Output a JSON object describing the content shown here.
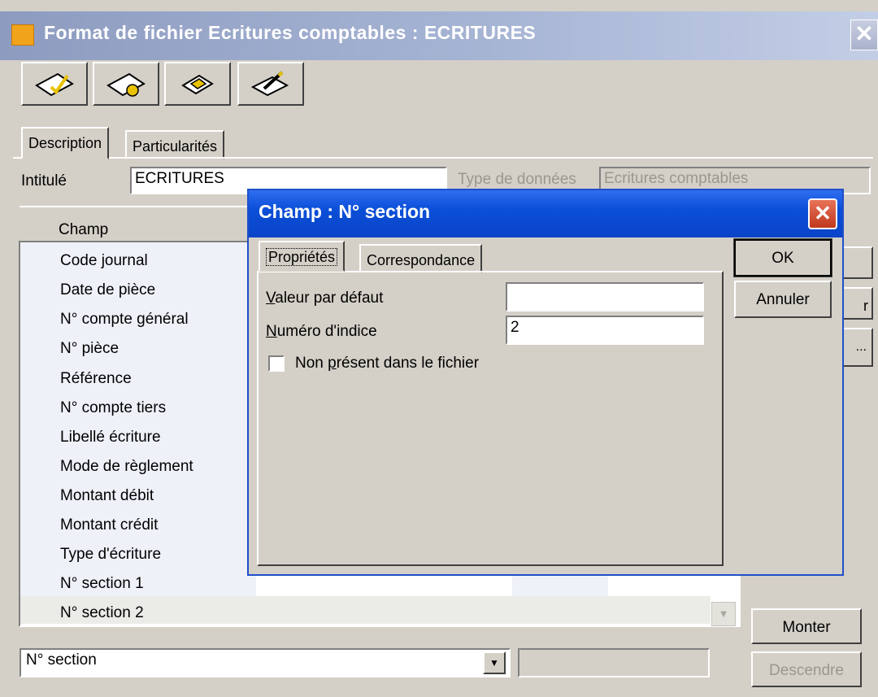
{
  "window": {
    "title": "Format de fichier Ecritures comptables : ECRITURES",
    "close": "✕"
  },
  "toolbar": {
    "buttons": [
      "validate-icon",
      "import-icon",
      "export-icon",
      "edit-icon"
    ]
  },
  "tabs": [
    "Description",
    "Particularités"
  ],
  "form": {
    "intitule_label": "Intitulé",
    "intitule_value": "ECRITURES",
    "type_label": "Type de données",
    "type_value": "Ecritures comptables"
  },
  "list": {
    "header": "Champ",
    "items": [
      "Code journal",
      "Date de pièce",
      "N° compte général",
      "N° pièce",
      "Référence",
      "N° compte tiers",
      "Libellé écriture",
      "Mode de règlement",
      "Montant débit",
      "Montant crédit",
      "Type d'écriture",
      "N° section 1",
      "N° section 2"
    ]
  },
  "side_buttons": {
    "partial_r": "r",
    "partial_dots": "..."
  },
  "bottom": {
    "field_type": "N° section",
    "monter": "Monter",
    "descendre": "Descendre"
  },
  "dialog": {
    "title": "Champ : N° section",
    "close": "✕",
    "tabs": [
      "Propriétés",
      "Correspondance"
    ],
    "valeur_label_first": "V",
    "valeur_label_rest": "aleur par défaut",
    "valeur_value": "",
    "numero_label_first": "N",
    "numero_label_rest": "uméro d'indice",
    "numero_value": "2",
    "checkbox_label_a": "Non ",
    "checkbox_label_u": "p",
    "checkbox_label_b": "résent dans le fichier",
    "ok": "OK",
    "cancel": "Annuler"
  },
  "colors": {
    "dialog_title": "#0a4fd8",
    "window_title": "#8d9bc0",
    "face": "#d4d0c8"
  }
}
